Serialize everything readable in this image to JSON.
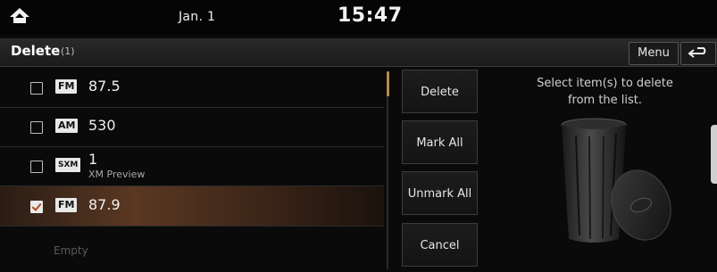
{
  "status": {
    "date": "Jan. 1",
    "time": "15:47"
  },
  "header": {
    "title": "Delete",
    "count": "(1)",
    "menu_label": "Menu"
  },
  "list": {
    "items": [
      {
        "band": "FM",
        "frequency": "87.5",
        "subtitle": "",
        "checked": false
      },
      {
        "band": "AM",
        "frequency": "530",
        "subtitle": "",
        "checked": false
      },
      {
        "band": "SXM",
        "frequency": "1",
        "subtitle": "XM Preview",
        "checked": false
      },
      {
        "band": "FM",
        "frequency": "87.9",
        "subtitle": "",
        "checked": true
      }
    ],
    "empty_label": "Empty"
  },
  "actions": {
    "delete_label": "Delete",
    "mark_all_label": "Mark All",
    "unmark_all_label": "Unmark All",
    "cancel_label": "Cancel"
  },
  "info": {
    "line1": "Select item(s) to delete",
    "line2": "from the list."
  },
  "icons": {
    "home": "home-icon",
    "back": "back-arrow-icon",
    "trash": "trash-can-icon"
  },
  "colors": {
    "accent": "#b8884f",
    "selected_row": "#5a3822"
  }
}
